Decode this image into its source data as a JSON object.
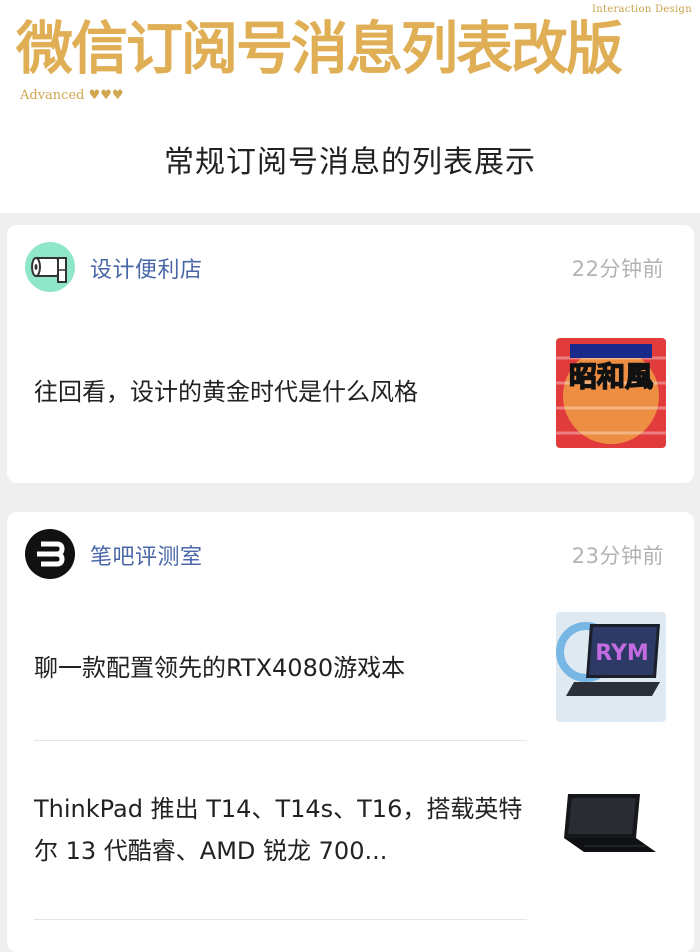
{
  "header": {
    "tag_small": "Interaction Design",
    "title": "微信订阅号消息列表改版",
    "advanced": "Advanced ♥♥♥",
    "subtitle": "常规订阅号消息的列表展示"
  },
  "cards": [
    {
      "account": "设计便利店",
      "time": "22分钟前",
      "icon": "toilet-paper-icon",
      "articles": [
        {
          "title": "往回看，设计的黄金时代是什么风格",
          "thumb_text": "昭和風"
        }
      ]
    },
    {
      "account": "笔吧评测室",
      "time": "23分钟前",
      "icon": "number-3-logo-icon",
      "articles": [
        {
          "title": "聊一款配置领先的RTX4080游戏本",
          "thumb": "laptop-image"
        },
        {
          "title": "ThinkPad 推出 T14、T14s、T16，搭载英特尔 13 代酷睿、AMD 锐龙 700...",
          "thumb": "laptop-image"
        }
      ]
    }
  ],
  "colors": {
    "title_gold": "#dfae55",
    "account_blue": "#4a67a8",
    "time_gray": "#b3b3b3",
    "background": "#efefef"
  }
}
